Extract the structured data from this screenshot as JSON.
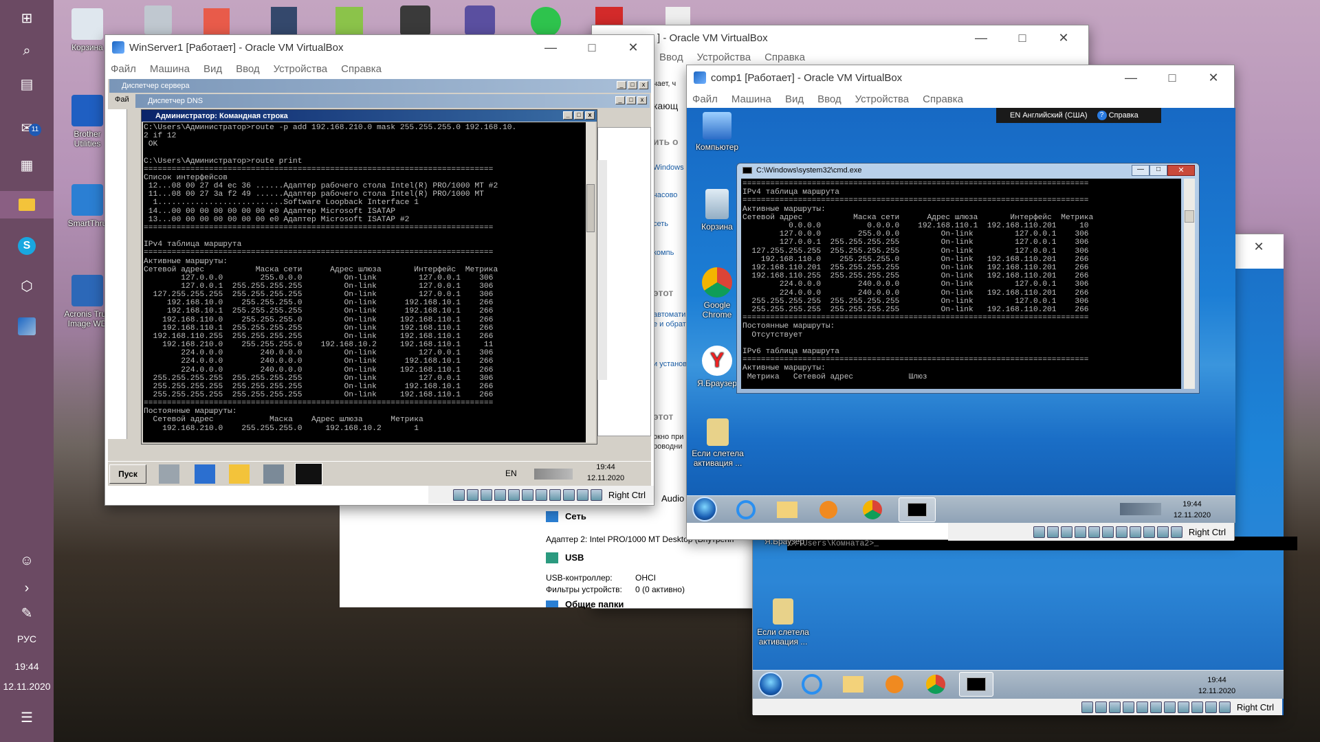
{
  "desktop": {
    "icons": [
      {
        "label": "Корзина"
      },
      {
        "label": "Brother Utilities"
      },
      {
        "label": "SmartThru"
      },
      {
        "label": "Acronis True Image WD"
      }
    ],
    "sidebar": {
      "lang": "РУС",
      "time": "19:44",
      "date": "12.11.2020",
      "badge": "11"
    }
  },
  "win_server": {
    "title": "WinServer1 [Работает] - Oracle VM VirtualBox",
    "menu": [
      "Файл",
      "Машина",
      "Вид",
      "Ввод",
      "Устройства",
      "Справка"
    ],
    "server_manager_title": "Диспетчер сервера",
    "dns_title": "Диспетчер DNS",
    "cmd_title": "Администратор: Командная строка",
    "cmd_text": "C:\\Users\\Администратор>route -p add 192.168.210.0 mask 255.255.255.0 192.168.10.\n2 if 12\n OK\n\nC:\\Users\\Администратор>route print\n===========================================================================\nСписок интерфейсов\n 12...08 00 27 d4 ec 36 ......Адаптер рабочего стола Intel(R) PRO/1000 MT #2\n 11...08 00 27 3a f2 49 ......Адаптер рабочего стола Intel(R) PRO/1000 MT\n  1...........................Software Loopback Interface 1\n 14...00 00 00 00 00 00 00 e0 Адаптер Microsoft ISATAP\n 13...00 00 00 00 00 00 00 e0 Адаптер Microsoft ISATAP #2\n===========================================================================\n\nIPv4 таблица маршрута\n===========================================================================\nАктивные маршруты:\nСетевой адрес           Маска сети      Адрес шлюза       Интерфейс  Метрика\n        127.0.0.0        255.0.0.0         On-link         127.0.0.1    306\n        127.0.0.1  255.255.255.255         On-link         127.0.0.1    306\n  127.255.255.255  255.255.255.255         On-link         127.0.0.1    306\n     192.168.10.0    255.255.255.0         On-link      192.168.10.1    266\n     192.168.10.1  255.255.255.255         On-link      192.168.10.1    266\n    192.168.110.0    255.255.255.0         On-link     192.168.110.1    266\n    192.168.110.1  255.255.255.255         On-link     192.168.110.1    266\n  192.168.110.255  255.255.255.255         On-link     192.168.110.1    266\n    192.168.210.0    255.255.255.0    192.168.10.2     192.168.110.1     11\n        224.0.0.0        240.0.0.0         On-link         127.0.0.1    306\n        224.0.0.0        240.0.0.0         On-link      192.168.10.1    266\n        224.0.0.0        240.0.0.0         On-link     192.168.110.1    266\n  255.255.255.255  255.255.255.255         On-link         127.0.0.1    306\n  255.255.255.255  255.255.255.255         On-link      192.168.10.1    266\n  255.255.255.255  255.255.255.255         On-link     192.168.110.1    266\n===========================================================================\nПостоянные маршруты:\n  Сетевой адрес            Маска    Адрес шлюза      Метрика\n    192.168.210.0    255.255.255.0     192.168.10.2       1",
    "side_label": "Фай",
    "taskbar": {
      "start": "Пуск",
      "lang": "EN",
      "time": "19:44",
      "date": "12.11.2020"
    },
    "hostkey": "Right Ctrl"
  },
  "win_behind": {
    "title_suffix": "] - Oracle VM VirtualBox",
    "menu": [
      "Ввод",
      "Устройства",
      "Справка"
    ],
    "snippets": [
      "чает, ч",
      "кающ",
      "ить о",
      "Windows",
      "часово",
      "сеть",
      "компь",
      "этот",
      "автомати",
      "е и обрат",
      "и установ",
      "этот",
      "окно при",
      "роводни",
      "Audio"
    ],
    "details": {
      "network_header": "Сеть",
      "adapter_line": "Адаптер 2:  Intel PRO/1000 MT Desktop (Внутренн",
      "usb_header": "USB",
      "usb_controller_label": "USB-контроллер:",
      "usb_controller_value": "OHCI",
      "filters_label": "Фильтры устройств:",
      "filters_value": "0 (0 активно)",
      "shared_header": "Общие папки"
    }
  },
  "comp1": {
    "title": "comp1 [Работает] - Oracle VM VirtualBox",
    "menu": [
      "Файл",
      "Машина",
      "Вид",
      "Ввод",
      "Устройства",
      "Справка"
    ],
    "langbar": "EN Английский (США)",
    "help": "Справка",
    "icons": [
      {
        "label": "Компьютер"
      },
      {
        "label": "Корзина"
      },
      {
        "label": "Google Chrome"
      },
      {
        "label": "Я.Браузер"
      },
      {
        "label": "Если слетела активация ..."
      }
    ],
    "cmd_title": "C:\\Windows\\system32\\cmd.exe",
    "cmd_text": "===========================================================================\nIPv4 таблица маршрута\n===========================================================================\nАктивные маршруты:\nСетевой адрес           Маска сети      Адрес шлюза       Интерфейс  Метрика\n          0.0.0.0          0.0.0.0    192.168.110.1  192.168.110.201     10\n        127.0.0.0        255.0.0.0         On-link         127.0.0.1    306\n        127.0.0.1  255.255.255.255         On-link         127.0.0.1    306\n  127.255.255.255  255.255.255.255         On-link         127.0.0.1    306\n    192.168.110.0    255.255.255.0         On-link   192.168.110.201    266\n  192.168.110.201  255.255.255.255         On-link   192.168.110.201    266\n  192.168.110.255  255.255.255.255         On-link   192.168.110.201    266\n        224.0.0.0        240.0.0.0         On-link         127.0.0.1    306\n        224.0.0.0        240.0.0.0         On-link   192.168.110.201    266\n  255.255.255.255  255.255.255.255         On-link         127.0.0.1    306\n  255.255.255.255  255.255.255.255         On-link   192.168.110.201    266\n===========================================================================\nПостоянные маршруты:\n  Отсутствует\n\nIPv6 таблица маршрута\n===========================================================================\nАктивные маршруты:\n Метрика   Сетевой адрес            Шлюз",
    "time": "19:44",
    "date": "12.11.2020",
    "hostkey": "Right Ctrl"
  },
  "comp2": {
    "prompt": "C:\\Users\\Комната2>_",
    "icons": [
      {
        "label": "Я.Браузер"
      },
      {
        "label": "Если слетела активация ..."
      }
    ],
    "time": "19:44",
    "date": "12.11.2020",
    "hostkey": "Right Ctrl"
  }
}
